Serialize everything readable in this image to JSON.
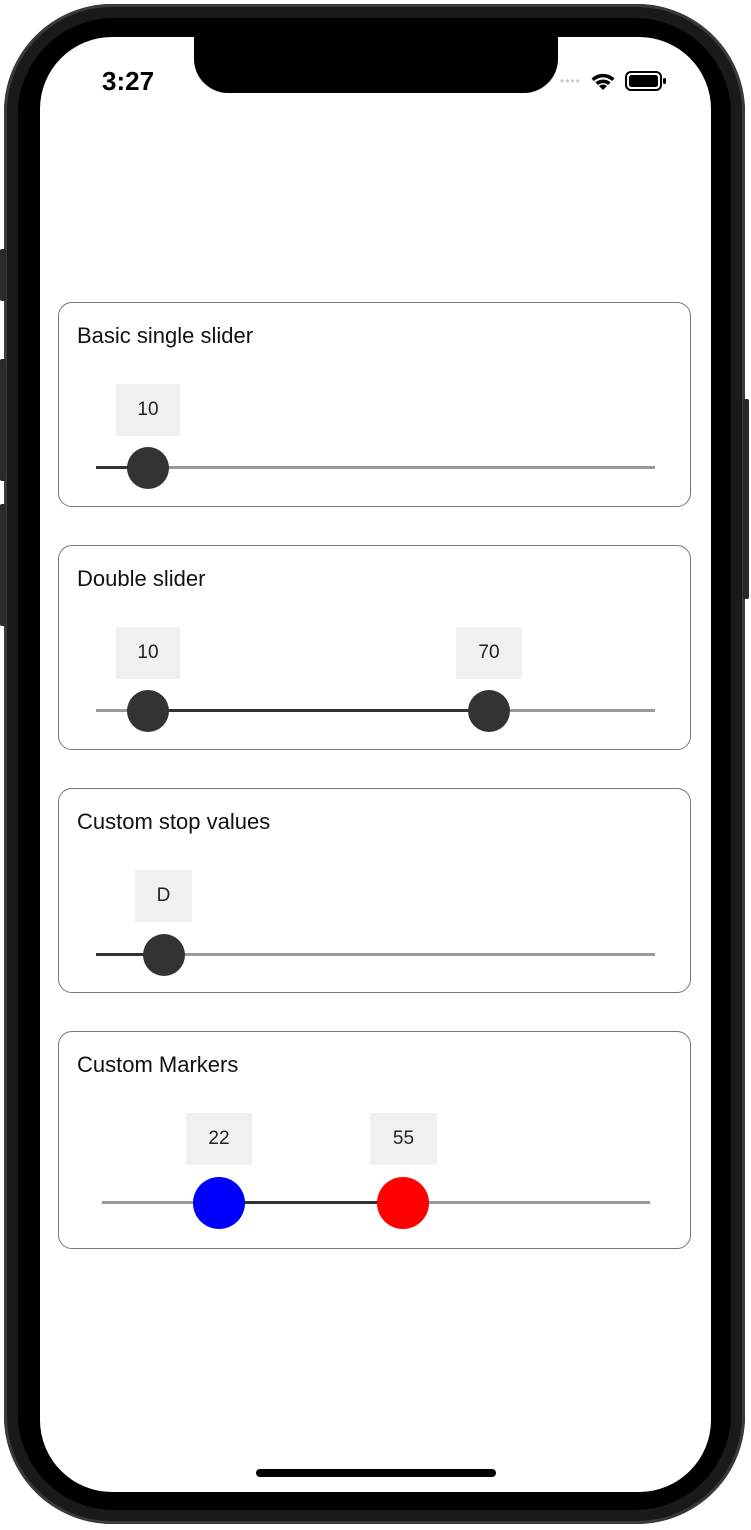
{
  "status_bar": {
    "time": "3:27"
  },
  "sliders": [
    {
      "title": "Basic single slider",
      "labels": [
        "10"
      ]
    },
    {
      "title": "Double slider",
      "labels": [
        "10",
        "70"
      ]
    },
    {
      "title": "Custom stop values",
      "labels": [
        "D"
      ]
    },
    {
      "title": "Custom Markers",
      "labels": [
        "22",
        "55"
      ],
      "marker_colors": [
        "#0000ff",
        "#ff0000"
      ]
    }
  ]
}
